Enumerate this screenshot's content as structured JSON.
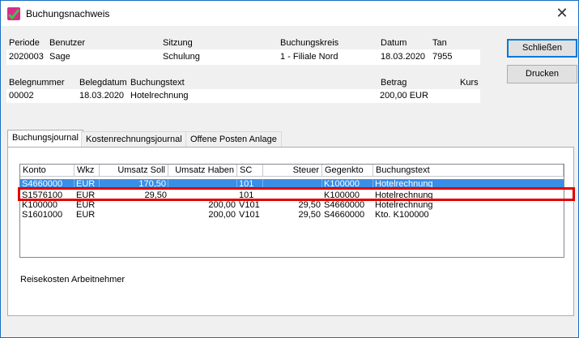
{
  "window": {
    "title": "Buchungsnachweis"
  },
  "header1": {
    "labels": [
      "Periode",
      "Benutzer",
      "Sitzung",
      "Buchungskreis",
      "Datum",
      "Tan"
    ],
    "values": [
      "2020003",
      "Sage",
      "Schulung",
      "1 - Filiale Nord",
      "18.03.2020",
      "7955"
    ]
  },
  "header2": {
    "labels": [
      "Belegnummer",
      "Belegdatum",
      "Buchungstext",
      "Betrag",
      "Kurs"
    ],
    "values": [
      "00002",
      "18.03.2020",
      "Hotelrechnung",
      "200,00 EUR",
      ""
    ]
  },
  "buttons": {
    "close": "Schließen",
    "print": "Drucken"
  },
  "tabs": [
    "Buchungsjournal",
    "Kostenrechnungsjournal",
    "Offene Posten Anlage"
  ],
  "grid": {
    "columns": [
      "Konto",
      "Wkz",
      "Umsatz Soll",
      "Umsatz Haben",
      "SC",
      "Steuer",
      "Gegenkto",
      "Buchungstext"
    ],
    "rows": [
      [
        "S4660000",
        "EUR",
        "170,50",
        "",
        "101",
        "",
        "K100000",
        "Hotelrechnung"
      ],
      [
        "S1576100",
        "EUR",
        "29,50",
        "",
        "101",
        "",
        "K100000",
        "Hotelrechnung"
      ],
      [
        "K100000",
        "EUR",
        "",
        "200,00",
        "V101",
        "29,50",
        "S4660000",
        "Hotelrechnung"
      ],
      [
        "S1601000",
        "EUR",
        "",
        "200,00",
        "V101",
        "29,50",
        "S4660000",
        "Kto. K100000"
      ]
    ]
  },
  "footer": {
    "text": "Reisekosten Arbeitnehmer"
  }
}
